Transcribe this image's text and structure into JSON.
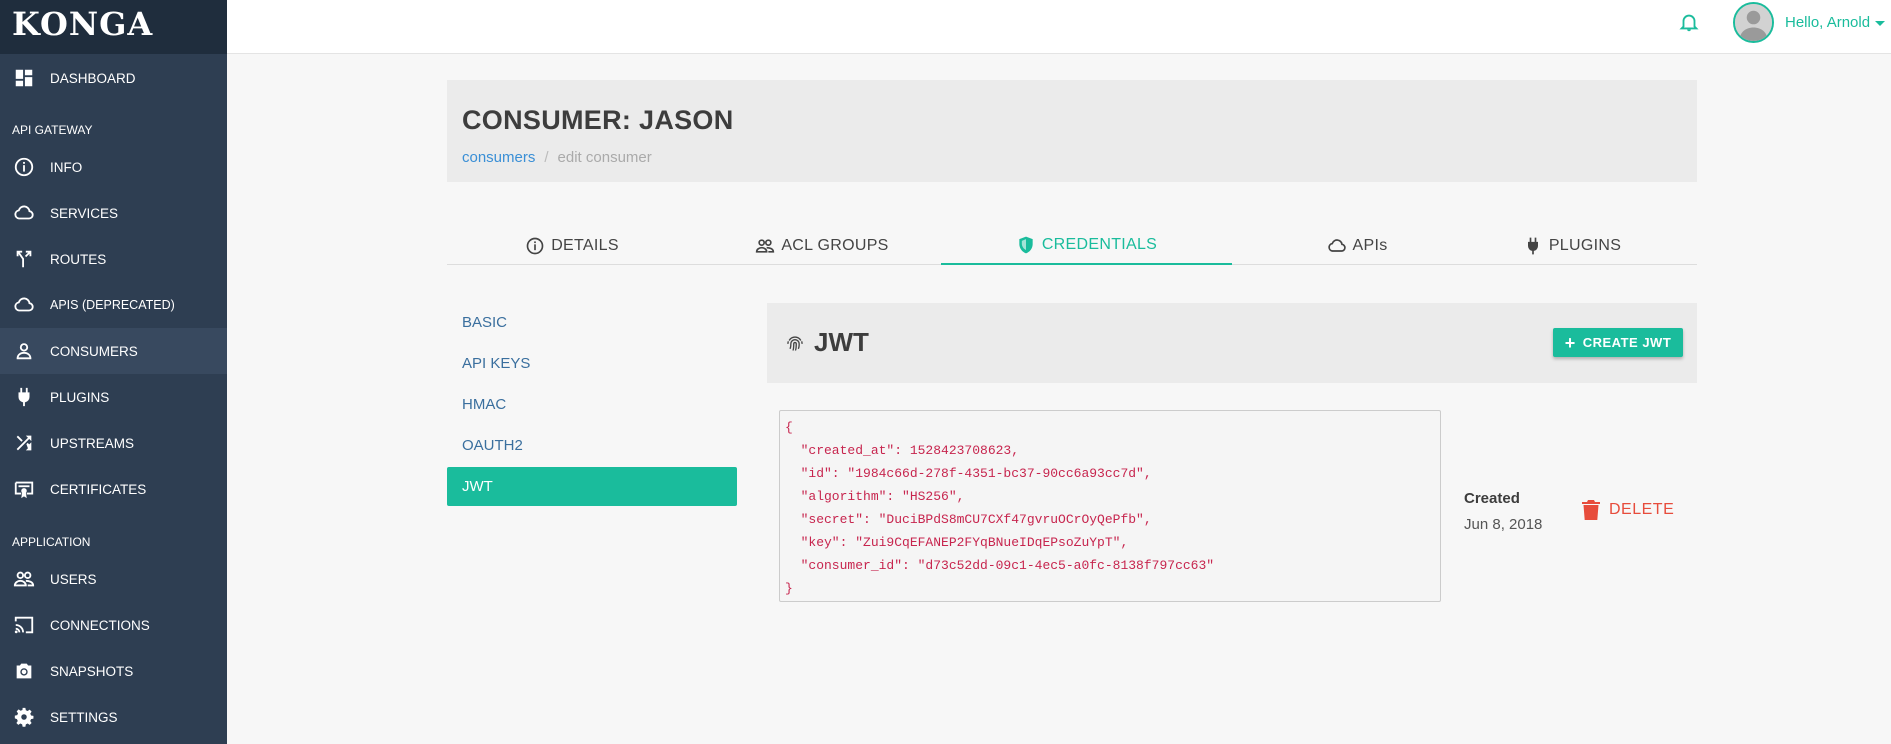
{
  "app": {
    "logo": "KONGA"
  },
  "sidebar": {
    "items": [
      {
        "label": "DASHBOARD",
        "icon": "dashboard-icon"
      },
      {
        "label": "INFO",
        "icon": "info-icon"
      },
      {
        "label": "SERVICES",
        "icon": "cloud-icon"
      },
      {
        "label": "ROUTES",
        "icon": "routes-icon"
      },
      {
        "label": "APIS (DEPRECATED)",
        "icon": "cloud-icon"
      },
      {
        "label": "CONSUMERS",
        "icon": "person-icon"
      },
      {
        "label": "PLUGINS",
        "icon": "plug-icon"
      },
      {
        "label": "UPSTREAMS",
        "icon": "shuffle-icon"
      },
      {
        "label": "CERTIFICATES",
        "icon": "certificate-icon"
      },
      {
        "label": "USERS",
        "icon": "users-icon"
      },
      {
        "label": "CONNECTIONS",
        "icon": "cast-icon"
      },
      {
        "label": "SNAPSHOTS",
        "icon": "camera-icon"
      },
      {
        "label": "SETTINGS",
        "icon": "gear-icon"
      }
    ],
    "sections": {
      "api_gateway": "API GATEWAY",
      "application": "APPLICATION"
    }
  },
  "topbar": {
    "greeting": "Hello, Arnold"
  },
  "header": {
    "title": "CONSUMER: JASON",
    "breadcrumb": {
      "link": "consumers",
      "separator": "/",
      "current": "edit consumer"
    }
  },
  "tabs": [
    {
      "label": "DETAILS",
      "icon": "info-icon"
    },
    {
      "label": "ACL GROUPS",
      "icon": "users-icon"
    },
    {
      "label": "CREDENTIALS",
      "icon": "shield-icon"
    },
    {
      "label": "APIs",
      "icon": "cloud-icon"
    },
    {
      "label": "PLUGINS",
      "icon": "plug-icon"
    }
  ],
  "credentials_menu": [
    "BASIC",
    "API KEYS",
    "HMAC",
    "OAUTH2",
    "JWT"
  ],
  "jwt": {
    "title": "JWT",
    "create_button": "CREATE JWT",
    "json": "{\n  \"created_at\": 1528423708623,\n  \"id\": \"1984c66d-278f-4351-bc37-90cc6a93cc7d\",\n  \"algorithm\": \"HS256\",\n  \"secret\": \"DuciBPdS8mCU7CXf47gvruOCrOyQePfb\",\n  \"key\": \"Zui9CqEFANEP2FYqBNueIDqEPsoZuYpT\",\n  \"consumer_id\": \"d73c52dd-09c1-4ec5-a0fc-8138f797cc63\"\n}",
    "created_label": "Created",
    "created_date": "Jun 8, 2018",
    "delete_label": "DELETE"
  },
  "colors": {
    "accent": "#1abc9c",
    "sidebar": "#2e3e52",
    "danger": "#e74c3c",
    "link": "#3a8fd6"
  }
}
